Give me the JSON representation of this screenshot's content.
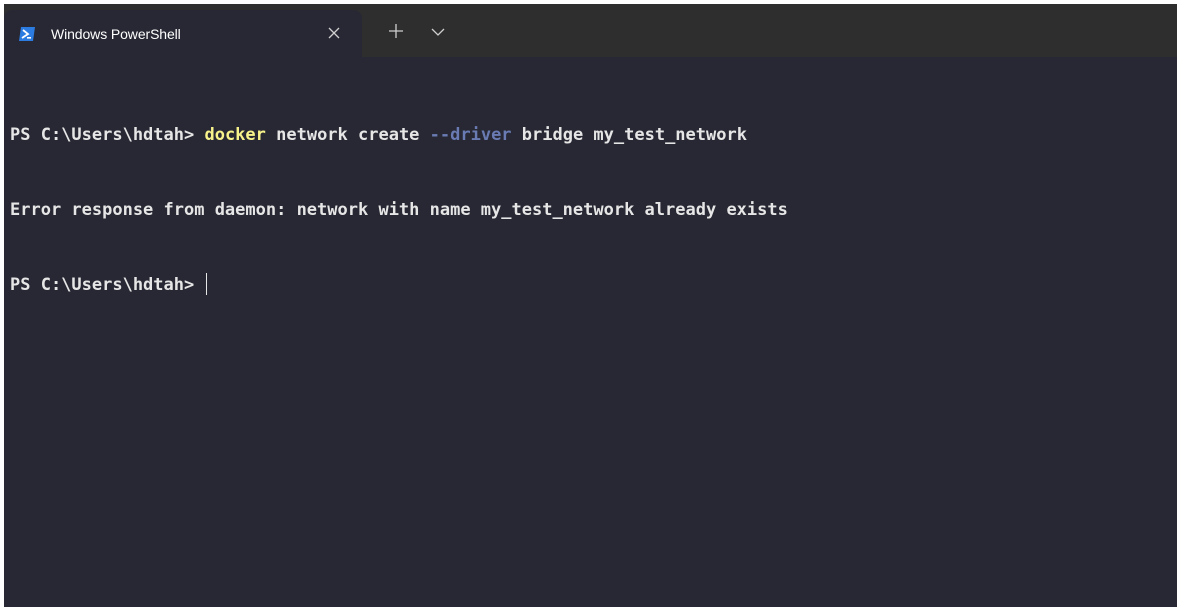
{
  "tab": {
    "title": "Windows PowerShell",
    "icon": "powershell-icon",
    "accent": "#2c7be0"
  },
  "tabbar": {
    "close_icon": "close-icon",
    "new_tab_icon": "plus-icon",
    "dropdown_icon": "chevron-down-icon"
  },
  "terminal": {
    "line1": {
      "prompt": "PS C:\\Users\\hdtah> ",
      "command": "docker",
      "args1": " network create ",
      "flag": "--driver",
      "args2": " bridge my_test_network"
    },
    "line2": {
      "text": "Error response from daemon: network with name my_test_network already exists"
    },
    "line3": {
      "prompt": "PS C:\\Users\\hdtah> "
    },
    "colors": {
      "background": "#272833",
      "text": "#e6e6e6",
      "command": "#f7f28a",
      "flag": "#6a7bb3"
    }
  }
}
